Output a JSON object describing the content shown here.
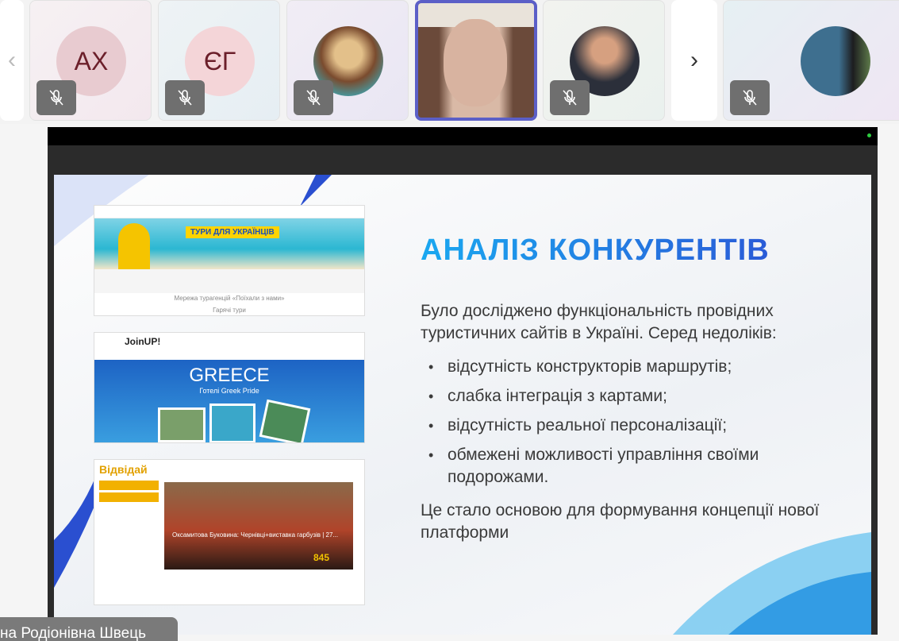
{
  "participants": [
    {
      "initials": "АХ",
      "muted": true
    },
    {
      "initials": "ЄГ",
      "muted": true
    },
    {
      "initials": "",
      "muted": true
    },
    {
      "initials": "",
      "muted": false,
      "active": true
    },
    {
      "initials": "",
      "muted": true
    },
    {
      "initials": "",
      "muted": true
    }
  ],
  "nav": {
    "prev_icon": "‹",
    "next_icon": "›"
  },
  "slide": {
    "title": "АНАЛІЗ КОНКУРЕНТІВ",
    "intro": "Було досліджено функціональність провідних туристичних сайтів в Україні. Серед недоліків:",
    "bullets": [
      "відсутність конструкторів маршрутів;",
      "слабка інтеграція з картами;",
      "відсутність реальної персоналізації;",
      "обмежені можливості управління своїми подорожами."
    ],
    "conclusion": "Це стало основою для формування концепції нової платформи",
    "screenshots": [
      {
        "banner_title": "ТУРИ ДЛЯ УКРАЇНЦІВ",
        "subtitle": "Мережа турагенцій «Поїхали з нами»",
        "section": "Гарячі тури"
      },
      {
        "logo": "JoinUP!",
        "banner_title": "GREECE",
        "banner_sub": "Готелі Greek Pride"
      },
      {
        "logo": "Відвідай",
        "caption": "Оксамитова Буковина: Чернівці+виставка гарбузів | 27...",
        "price": "845"
      }
    ]
  },
  "speaker_name": "на Родіонівна Швець",
  "colors": {
    "active_border": "#5b5fc7",
    "accent": "#2a7fe0"
  }
}
